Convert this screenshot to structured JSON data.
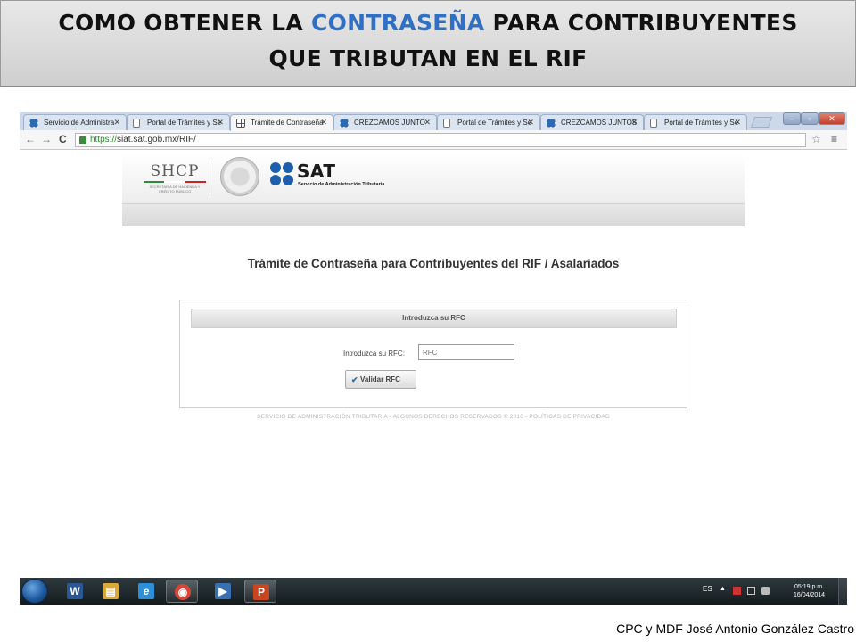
{
  "slide": {
    "title_line1_part1": "COMO OBTENER LA ",
    "title_line1_accent": "CONTRASEÑA",
    "title_line1_part2": " PARA CONTRIBUYENTES",
    "title_line2": "QUE TRIBUTAN EN EL RIF",
    "credit": "CPC y MDF José Antonio González Castro",
    "accent_color": "#2f6fc4"
  },
  "browser": {
    "tabs": [
      {
        "label": "Servicio de Administra",
        "icon": "sat-icon",
        "active": false
      },
      {
        "label": "Portal de Trámites y Se",
        "icon": "document-icon",
        "active": false
      },
      {
        "label": "Trámite de Contraseña",
        "icon": "grid-icon",
        "active": true
      },
      {
        "label": "CREZCAMOS JUNTO",
        "icon": "sat-icon",
        "active": false
      },
      {
        "label": "Portal de Trámites y Se",
        "icon": "document-icon",
        "active": false
      },
      {
        "label": "CREZCAMOS JUNTOS",
        "icon": "sat-icon",
        "active": false
      },
      {
        "label": "Portal de Trámites y Se",
        "icon": "document-icon",
        "active": false
      }
    ],
    "url_scheme": "https://",
    "url_rest": "siat.sat.gob.mx/RIF/"
  },
  "page": {
    "shcp_logo": "SHCP",
    "shcp_sub": "Secretaría de Hacienda y Crédito Público",
    "sat_logo": "SAT",
    "sat_sub": "Servicio de Administración Tributaria",
    "title": "Trámite de Contraseña para Contribuyentes del RIF / Asalariados",
    "panel_header": "Introduzca su RFC",
    "rfc_label": "Introduzca su RFC:",
    "rfc_placeholder": "RFC",
    "validate_button": "Validar RFC",
    "footer": "SERVICIO DE ADMINISTRACIÓN TRIBUTARIA - ALGUNOS DERECHOS RESERVADOS © 2010 - POLÍTICAS DE PRIVACIDAD"
  },
  "taskbar": {
    "apps": [
      {
        "name": "word-icon",
        "glyph": "W",
        "color": "#2b5797",
        "active": false
      },
      {
        "name": "file-explorer-icon",
        "glyph": "▤",
        "color": "#d9a93a",
        "active": false
      },
      {
        "name": "internet-explorer-icon",
        "glyph": "e",
        "color": "#2e8fd6",
        "active": false
      },
      {
        "name": "chrome-icon",
        "glyph": "◉",
        "color": "#d4473a",
        "active": true
      },
      {
        "name": "media-player-icon",
        "glyph": "▶",
        "color": "#3a6fb0",
        "active": false
      },
      {
        "name": "powerpoint-icon",
        "glyph": "P",
        "color": "#c9451f",
        "active": true
      }
    ],
    "language": "ES",
    "time": "05:19 p.m.",
    "date": "16/04/2014"
  }
}
